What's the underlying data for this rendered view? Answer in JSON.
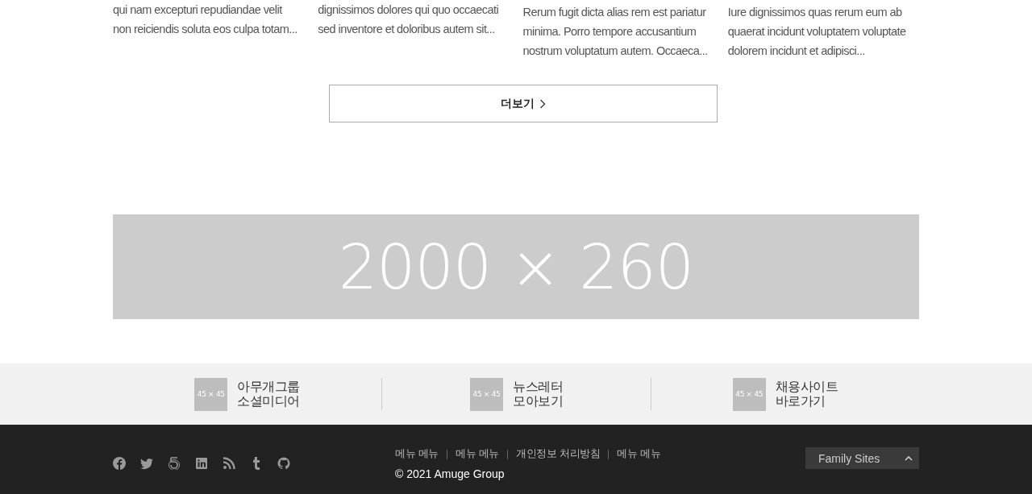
{
  "cards": [
    {
      "lines": [
        "qui nam excepturi repudiandae velit",
        "non reiciendis soluta eos culpa totam..."
      ]
    },
    {
      "lines": [
        "dignissimos dolores qui quo occaecati",
        "sed inventore et doloribus autem sit..."
      ]
    },
    {
      "lines": [
        "Rerum fugit dicta alias rem est pariatur",
        "minima. Porro tempore accusantium",
        "nostrum voluptatum autem. Occaeca..."
      ]
    },
    {
      "lines": [
        "Iure dignissimos quas rerum eum ab",
        "quaerat incidunt voluptatem voluptate",
        "dolorem incidunt et adipisci..."
      ]
    }
  ],
  "more_button": {
    "label": "더보기"
  },
  "banner": {
    "label": "2000 × 260"
  },
  "quick_links": [
    {
      "thumb": "45 × 45",
      "lines": [
        "아무개그룹",
        "소셜미디어"
      ]
    },
    {
      "thumb": "45 × 45",
      "lines": [
        "뉴스레터",
        "모아보기"
      ]
    },
    {
      "thumb": "45 × 45",
      "lines": [
        "채용사이트",
        "바로가기"
      ]
    }
  ],
  "footer": {
    "socials": [
      {
        "kind": "f-circle"
      },
      {
        "kind": "bird"
      },
      {
        "kind": "spiral"
      },
      {
        "kind": "in-square"
      },
      {
        "kind": "rss"
      },
      {
        "kind": "t-letter"
      },
      {
        "kind": "cat"
      }
    ],
    "menu": [
      "메뉴 메뉴",
      "메뉴 메뉴",
      "개인정보 처리방침",
      "메뉴 메뉴"
    ],
    "copyright": "© 2021 Amuge Group",
    "family_sites": {
      "label": "Family Sites"
    }
  }
}
